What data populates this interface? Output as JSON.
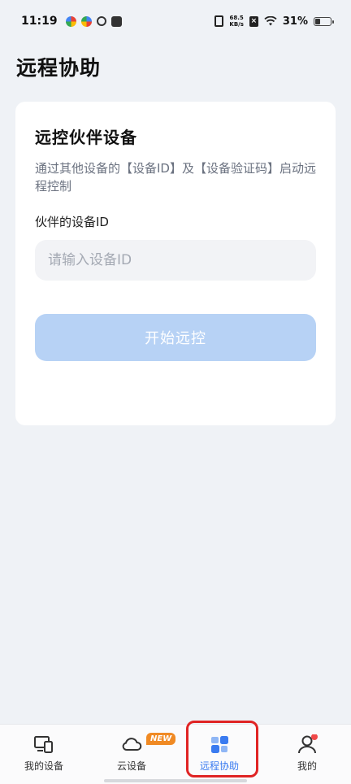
{
  "status_bar": {
    "time": "11:19",
    "net_speed_value": "68.5",
    "net_speed_unit": "KB/s",
    "sim_badge": "×",
    "battery_percent": "31%",
    "battery_level": 0.31
  },
  "page": {
    "title": "远程协助"
  },
  "card": {
    "title": "远控伙伴设备",
    "description": "通过其他设备的【设备ID】及【设备验证码】启动远程控制",
    "field_label": "伙伴的设备ID",
    "input_placeholder": "请输入设备ID",
    "input_value": "",
    "start_button_label": "开始远控"
  },
  "bottom_nav": {
    "items": [
      {
        "label": "我的设备",
        "icon": "devices-icon"
      },
      {
        "label": "云设备",
        "icon": "cloud-icon",
        "badge": "NEW"
      },
      {
        "label": "远程协助",
        "icon": "remote-assist-icon",
        "active": true
      },
      {
        "label": "我的",
        "icon": "profile-icon",
        "dot": true
      }
    ]
  },
  "colors": {
    "accent": "#3a7bf0",
    "button_disabled": "#b7d2f5",
    "badge": "#f08a24",
    "highlight": "#e02424"
  }
}
